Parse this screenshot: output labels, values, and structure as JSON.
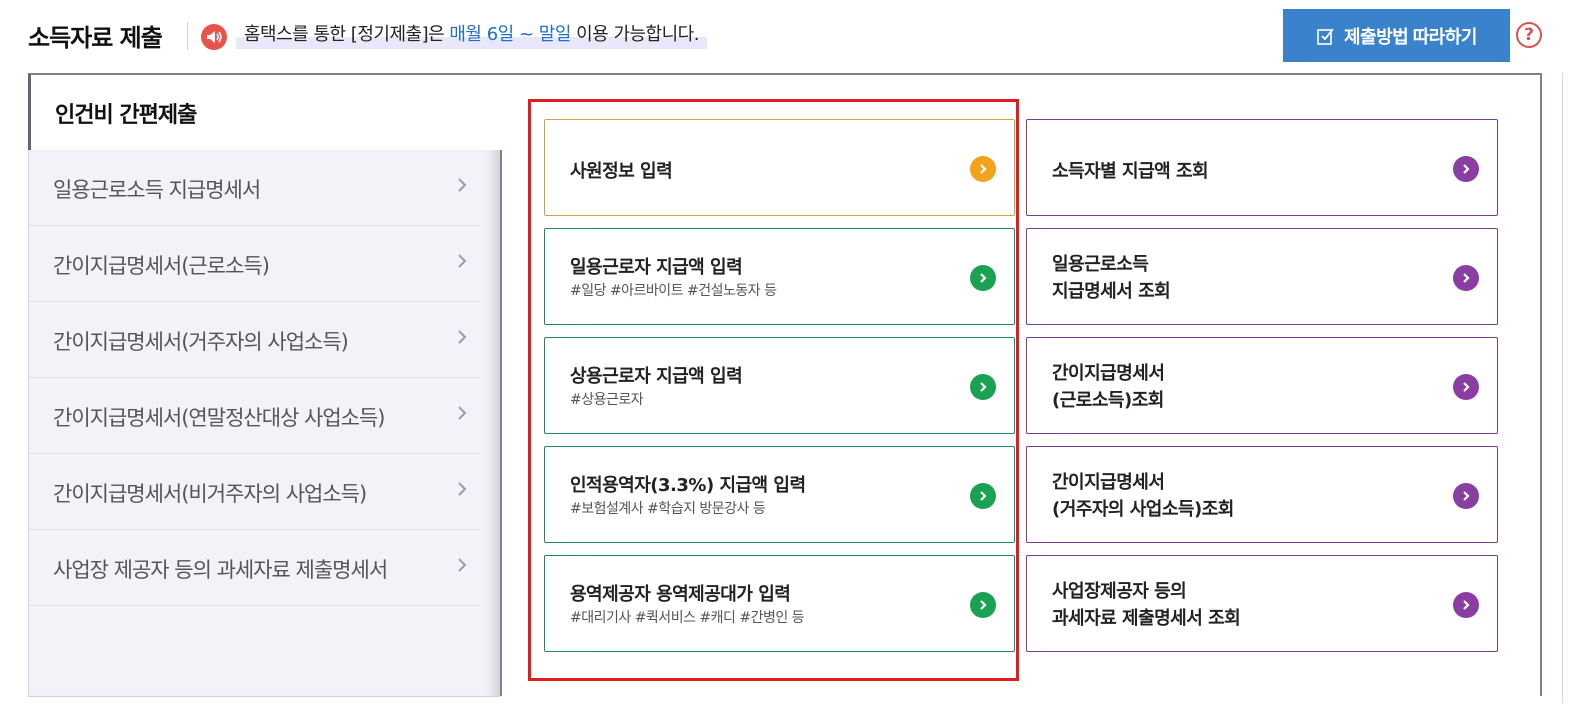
{
  "header": {
    "title": "소득자료 제출",
    "notice": {
      "pre": "홈택스를 통한 [정기제출]은 ",
      "highlight": "매월 6일 ~ 말일",
      "post": " 이용 가능합니다."
    },
    "guide_button_label": "제출방법 따라하기",
    "help_label": "?"
  },
  "sidebar": {
    "active_tab": "인건비 간편제출",
    "items": [
      {
        "label": "일용근로소득 지급명세서"
      },
      {
        "label": "간이지급명세서(근로소득)"
      },
      {
        "label": "간이지급명세서(거주자의 사업소득)"
      },
      {
        "label": "간이지급명세서(연말정산대상 사업소득)"
      },
      {
        "label": "간이지급명세서(비거주자의 사업소득)"
      },
      {
        "label": "사업장 제공자 등의 과세자료 제출명세서"
      }
    ]
  },
  "input_cards": [
    {
      "title": "사원정보 입력",
      "sub": ""
    },
    {
      "title": "일용근로자 지급액 입력",
      "sub": "#일당 #아르바이트 #건설노동자 등"
    },
    {
      "title": "상용근로자 지급액 입력",
      "sub": "#상용근로자"
    },
    {
      "title": "인적용역자(3.3%) 지급액 입력",
      "sub": "#보험설계사 #학습지 방문강사 등"
    },
    {
      "title": "용역제공자 용역제공대가 입력",
      "sub": "#대리기사 #퀵서비스 #캐디 #간병인 등"
    }
  ],
  "query_cards": [
    {
      "line1": "소득자별 지급액 조회",
      "line2": ""
    },
    {
      "line1": "일용근로소득",
      "line2": "지급명세서 조회"
    },
    {
      "line1": "간이지급명세서",
      "line2": "(근로소득)조회"
    },
    {
      "line1": "간이지급명세서",
      "line2": "(거주자의 사업소득)조회"
    },
    {
      "line1": "사업장제공자 등의",
      "line2": "과세자료 제출명세서 조회"
    }
  ],
  "colors": {
    "accent_blue": "#3a82cc",
    "highlight_red": "#e21d1d",
    "orange": "#f2a31b",
    "green": "#1aa152",
    "purple": "#8b3ea1"
  }
}
